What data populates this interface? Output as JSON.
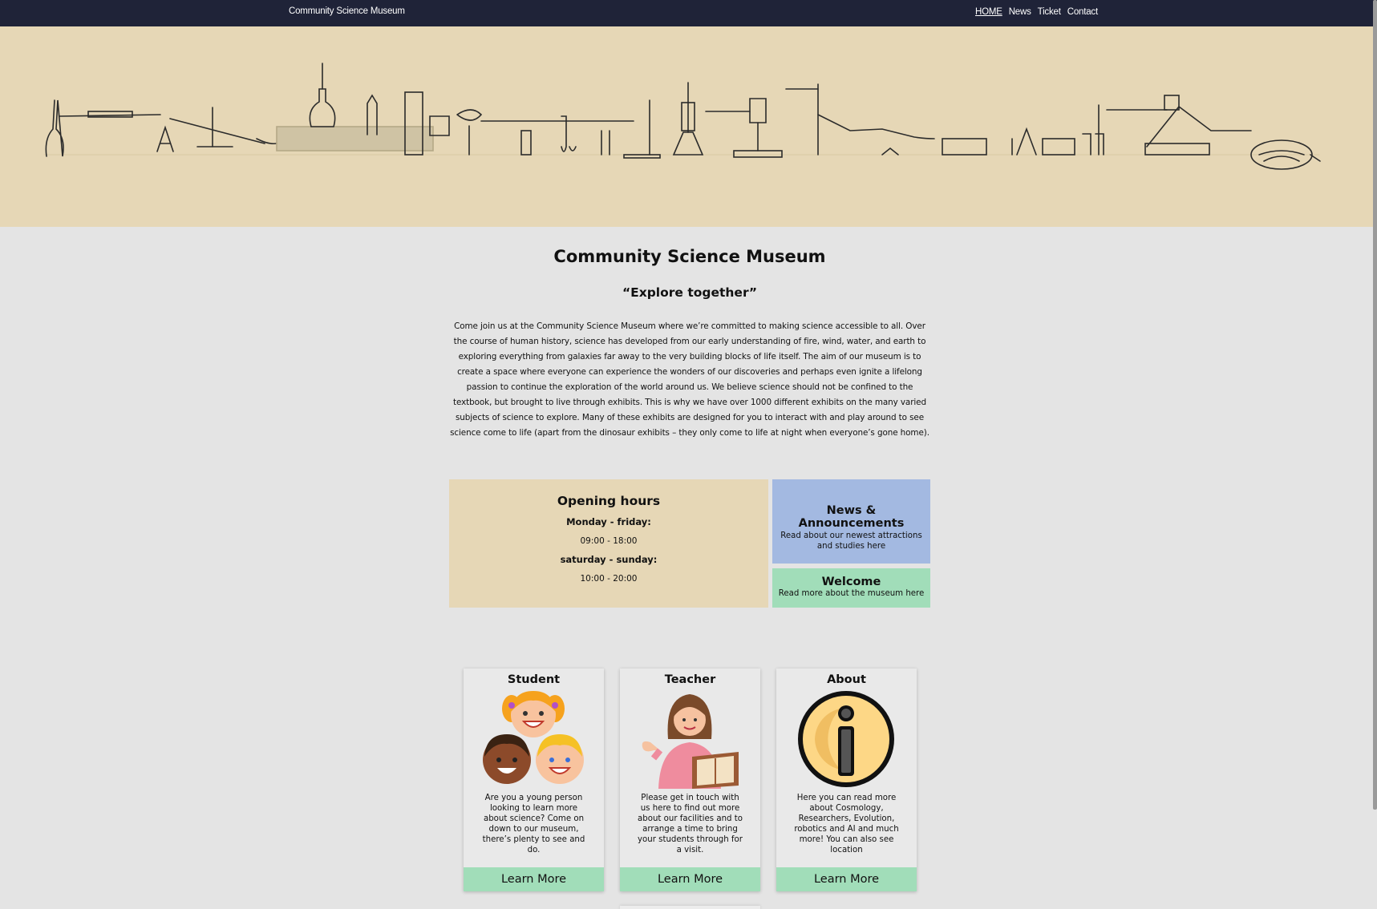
{
  "nav": {
    "brand": "Community Science Museum",
    "links": [
      "HOME",
      "News",
      "Ticket",
      "Contact"
    ]
  },
  "main": {
    "title": "Community Science Museum",
    "tagline": "“Explore together”",
    "intro": "Come join us at the Community Science Museum where we’re committed to making science accessible to all. Over the course of human history, science has developed from our early understanding of fire, wind, water, and earth to exploring everything from galaxies far away to the very building blocks of life itself. The aim of our museum is to create a space where everyone can experience the wonders of our discoveries and perhaps even ignite a lifelong passion to continue the exploration of the world around us. We believe science should not be confined to the textbook, but brought to live through exhibits. This is why we have over 1000 different exhibits on the many varied subjects of science to explore. Many of these exhibits are designed for you to interact with and play around to see science come to life (apart from the dinosaur exhibits – they only come to life at night when everyone’s gone home)."
  },
  "hours": {
    "title": "Opening hours",
    "weekday_label": "Monday - friday:",
    "weekday_time": "09:00 - 18:00",
    "weekend_label": "saturday - sunday:",
    "weekend_time": "10:00 - 20:00"
  },
  "news": {
    "title": "News & Announcements",
    "text": "Read about our newest attractions and studies here"
  },
  "welcome": {
    "title": "Welcome",
    "text": "Read more about the museum here"
  },
  "cards": [
    {
      "title": "Student",
      "text": "Are you a young person looking to learn more about science? Come on down to our museum, there’s plenty to see and do.",
      "button": "Learn More"
    },
    {
      "title": "Teacher",
      "text": "Please get in touch with us here to find out more about our facilities and to arrange a time to bring your students through for a visit.",
      "button": "Learn More"
    },
    {
      "title": "About",
      "text": "Here you can read more about Cosmology, Researchers, Evolution, robotics and AI and much more! You can also see location",
      "button": "Learn More"
    }
  ],
  "colors": {
    "navbar": "#1f2338",
    "beige": "#e6d7b6",
    "blue": "#a3b9e1",
    "green": "#a1ddb9",
    "page": "#e4e4e4"
  }
}
